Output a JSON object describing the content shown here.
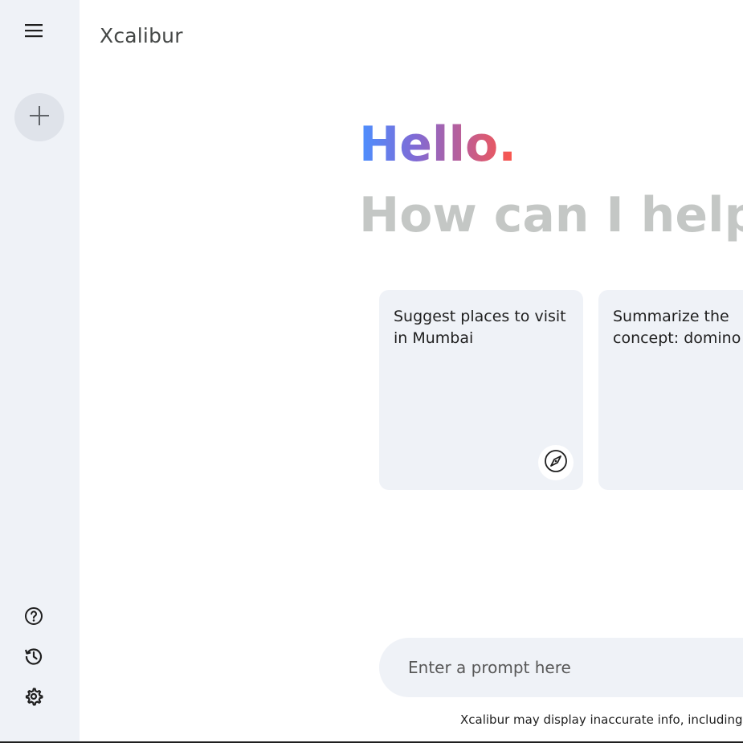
{
  "app": {
    "title": "Xcalibur"
  },
  "sidebar": {
    "menu_icon": "menu-icon",
    "new_chat_icon": "plus-icon",
    "bottom_items": [
      {
        "icon": "help-icon"
      },
      {
        "icon": "history-icon"
      },
      {
        "icon": "settings-icon"
      }
    ]
  },
  "greeting": {
    "hello": "Hello.",
    "subtitle": "How can I help y"
  },
  "cards": [
    {
      "text": "Suggest places to visit in Mumbai",
      "icon": "compass-icon"
    },
    {
      "text": "Summarize the concept: domino"
    }
  ],
  "prompt": {
    "placeholder": "Enter a prompt here"
  },
  "disclaimer": "Xcalibur may display inaccurate info, including ab",
  "colors": {
    "sidebar_bg": "#eff2f7",
    "card_bg": "#eff2f7",
    "subtitle": "#c4c7c5",
    "gradient_start": "#4b90ff",
    "gradient_end": "#ff5546"
  }
}
